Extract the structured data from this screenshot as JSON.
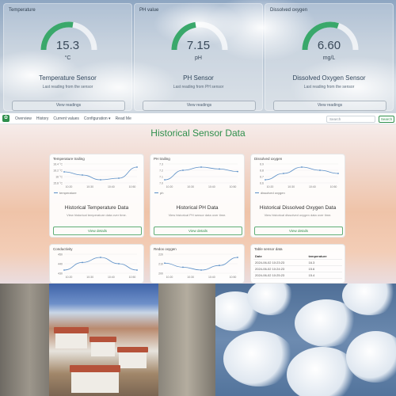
{
  "gauges": [
    {
      "title": "Temperature",
      "value": "15.3",
      "unit": "°C",
      "name": "Temperature Sensor",
      "subtitle": "Last reading from the sensor",
      "button": "View readings",
      "level": 0.55,
      "color": "#3aa86b"
    },
    {
      "title": "PH value",
      "value": "7.15",
      "unit": "pH",
      "name": "PH Sensor",
      "subtitle": "Last reading from PH sensor",
      "button": "View readings",
      "level": 0.45,
      "color": "#3aa86b"
    },
    {
      "title": "Dissolved oxygen",
      "value": "6.60",
      "unit": "mg/L",
      "name": "Dissolved Oxygen Sensor",
      "subtitle": "Last reading from the sensor",
      "button": "View readings",
      "level": 0.6,
      "color": "#3aa86b"
    }
  ],
  "navbar": {
    "brand_icon": "leaf-icon",
    "links": [
      "Overview",
      "History",
      "Current values",
      "Configuration ▾",
      "Read Me"
    ],
    "search_placeholder": "Search",
    "search_button": "Search"
  },
  "historical": {
    "title": "Historical Sensor Data",
    "cards": [
      {
        "chart_title": "Temperature trailing",
        "legend": "temperature",
        "name": "Historical Temperature Data",
        "desc": "View historical temperature data over time.",
        "button": "View details"
      },
      {
        "chart_title": "PH trailing",
        "legend": "ph",
        "name": "Historical PH Data",
        "desc": "View historical PH sensor data over time.",
        "button": "View details"
      },
      {
        "chart_title": "Dissolved oxygen",
        "legend": "dissolved oxygen",
        "name": "Historical Dissolved Oxygen Data",
        "desc": "View historical dissolved oxygen data over time.",
        "button": "View details"
      },
      {
        "chart_title": "Conductivity",
        "legend": "",
        "name": "",
        "desc": "",
        "button": ""
      },
      {
        "chart_title": "Redox oxygen",
        "legend": "",
        "name": "",
        "desc": "",
        "button": ""
      }
    ],
    "table": {
      "title": "Table sensor data",
      "headers": [
        "Date",
        "temperature"
      ],
      "rows": [
        [
          "2024-06-02 10:23:23",
          "16.3"
        ],
        [
          "2024-06-02 10:24:23",
          "15.6"
        ],
        [
          "2024-06-02 10:25:23",
          "15.4"
        ]
      ]
    }
  },
  "chart_data": [
    {
      "type": "line",
      "title": "Temperature trailing",
      "x": [
        "10:20",
        "10:30",
        "10:40",
        "10:50"
      ],
      "yticks": [
        "16.4 °C",
        "16.2 °C",
        "16 °C",
        "15.8 °C"
      ],
      "values": [
        16.2,
        16.1,
        15.95,
        16.0,
        16.35
      ],
      "series_name": "temperature"
    },
    {
      "type": "line",
      "title": "PH trailing",
      "x": [
        "10:20",
        "10:30",
        "10:40",
        "10:50"
      ],
      "yticks": [
        "7.3",
        "7.2",
        "7.1",
        "7.0"
      ],
      "values": [
        7.05,
        7.2,
        7.25,
        7.22,
        7.18
      ],
      "series_name": "ph"
    },
    {
      "type": "line",
      "title": "Dissolved oxygen",
      "x": [
        "10:20",
        "10:30",
        "10:40",
        "10:50"
      ],
      "yticks": [
        "6.9",
        "6.8",
        "6.7",
        "6.6"
      ],
      "values": [
        6.7,
        6.8,
        6.9,
        6.85,
        6.8
      ],
      "series_name": "dissolved oxygen"
    },
    {
      "type": "line",
      "title": "Conductivity",
      "x": [
        "10:20",
        "10:30",
        "10:40",
        "10:50"
      ],
      "yticks": [
        "450",
        "440",
        "430"
      ],
      "values": [
        440,
        452,
        460,
        450,
        440
      ]
    },
    {
      "type": "line",
      "title": "Redox oxygen",
      "x": [
        "10:20",
        "10:30",
        "10:40",
        "10:50"
      ],
      "yticks": [
        "220",
        "210",
        "200"
      ],
      "values": [
        212,
        205,
        200,
        208,
        222
      ]
    }
  ]
}
